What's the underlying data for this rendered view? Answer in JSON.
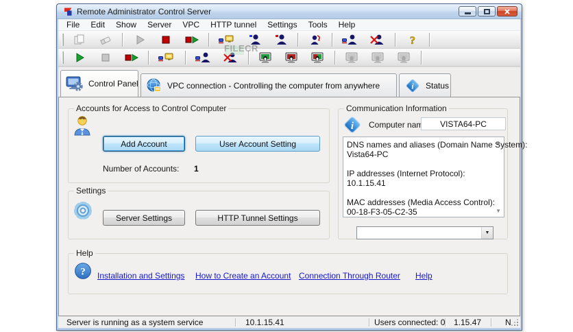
{
  "window": {
    "title": "Remote Administrator Control Server",
    "watermark": "FILECR"
  },
  "menu": {
    "items": [
      "File",
      "Edit",
      "Show",
      "Server",
      "VPC",
      "HTTP tunnel",
      "Settings",
      "Tools",
      "Help"
    ]
  },
  "toolbars": {
    "row1": [
      "copy",
      "erase",
      "start",
      "stop",
      "restart",
      "activate-connections",
      "user-accounts",
      "user-sessions",
      "refresh-user",
      "connect-user",
      "disconnect-user",
      "help"
    ],
    "row2": [
      "start-server",
      "stop-server",
      "restart-server",
      "connect-computer",
      "add-connection",
      "remove-connection",
      "screen-on",
      "screen-off",
      "screen-toggle",
      "viewer-1",
      "viewer-2",
      "viewer-3"
    ]
  },
  "tabs": [
    {
      "label": "Control Panel"
    },
    {
      "label": "VPC connection - Controlling the computer from anywhere"
    },
    {
      "label": "Status"
    }
  ],
  "accounts": {
    "title": "Accounts for Access to Control Computer",
    "add_button": "Add Account",
    "setting_button": "User Account Setting",
    "count_label": "Number of Accounts:",
    "count_value": "1"
  },
  "settings": {
    "title": "Settings",
    "server_button": "Server Settings",
    "tunnel_button": "HTTP Tunnel Settings"
  },
  "communication": {
    "title": "Communication Information",
    "computer_name_label": "Computer name:",
    "computer_name_value": "VISTA64-PC",
    "details": [
      "DNS names and aliases (Domain Name System):",
      "Vista64-PC",
      "",
      "IP addresses (Internet Protocol):",
      "10.1.15.41",
      "",
      "MAC addresses (Media Access Control):",
      "00-18-F3-05-C2-35"
    ],
    "dropdown_value": ""
  },
  "help": {
    "title": "Help",
    "links": [
      "Installation and Settings",
      "How to Create an Account",
      "Connection Through Router",
      "Help"
    ]
  },
  "statusbar": {
    "panels": [
      "Server is running as a system service",
      "10.1.15.41",
      "Users connected: 0",
      "1.15.47",
      "N"
    ]
  },
  "colors": {
    "accent_blue": "#3c7fb1",
    "link_blue": "#1616cf",
    "close_red": "#cc4526"
  }
}
